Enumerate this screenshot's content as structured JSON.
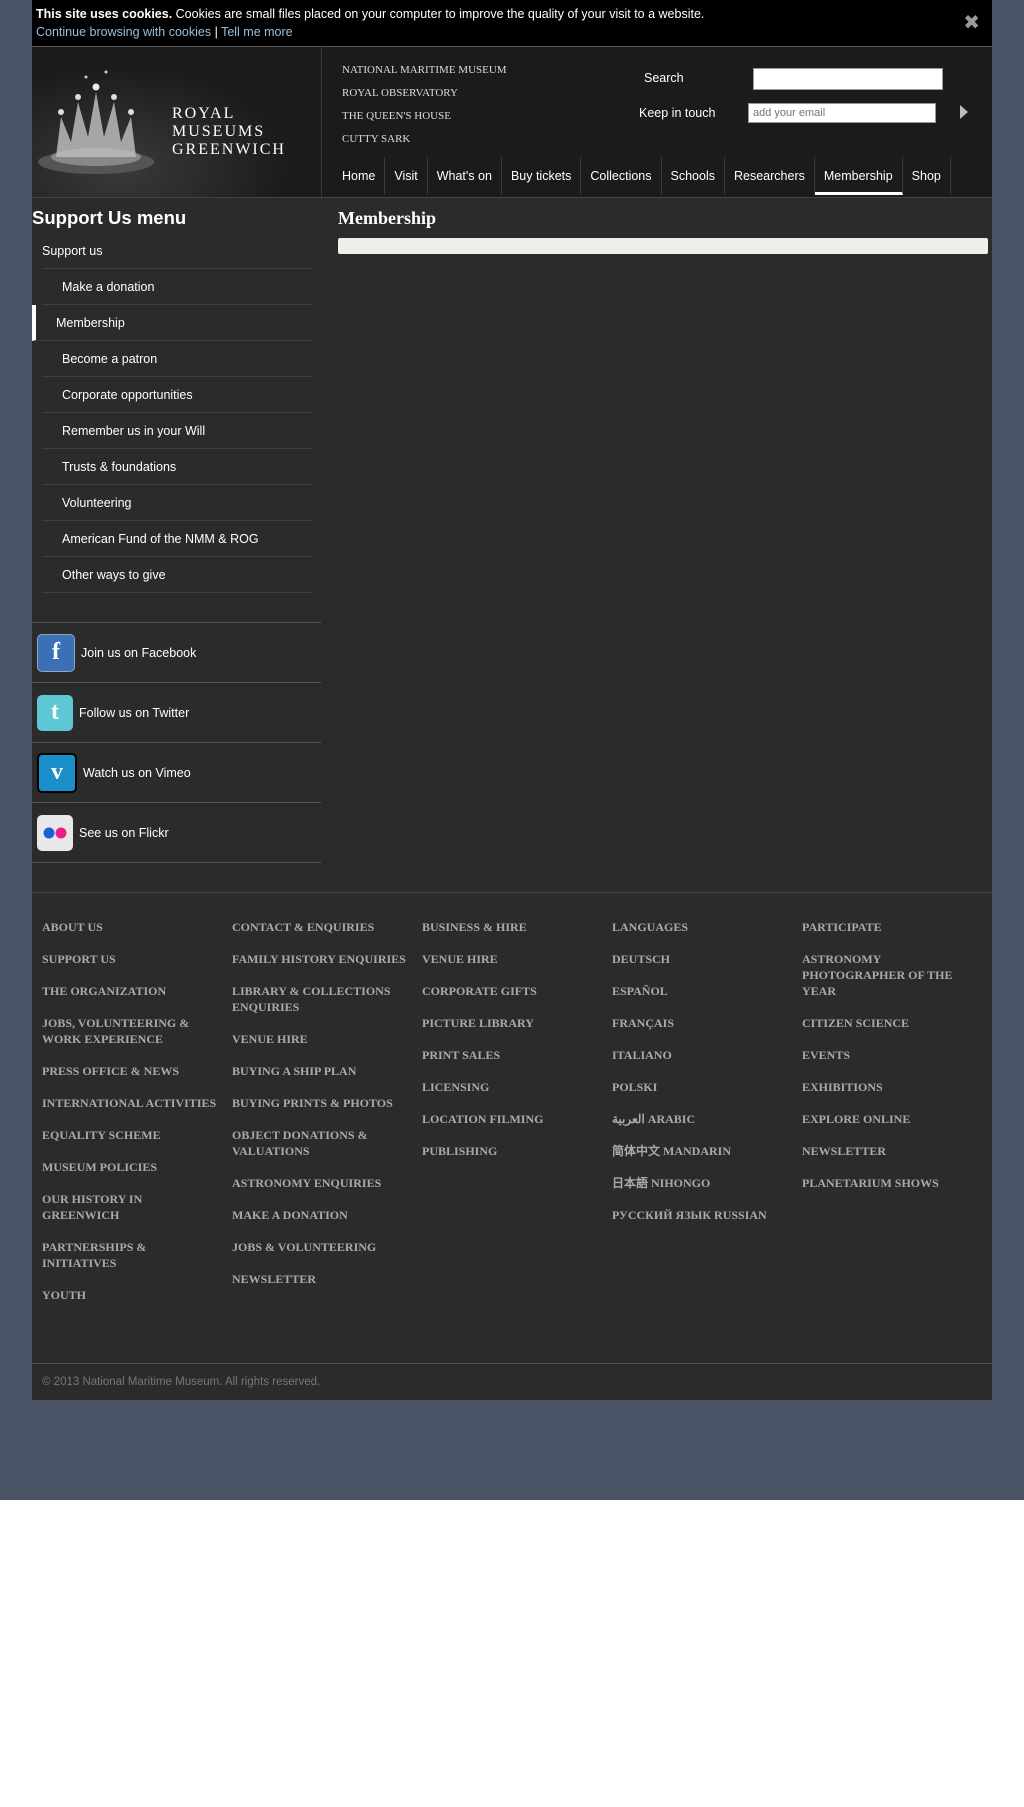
{
  "cookie": {
    "bold": "This site uses cookies.",
    "text": "Cookies are small files placed on your computer to improve the quality of your visit to a website.",
    "continue_link": "Continue browsing with cookies",
    "separator": "|",
    "tell_link": "Tell me more",
    "close_glyph": "✖"
  },
  "brand": {
    "line1": "ROYAL",
    "line2": "MUSEUMS",
    "line3": "GREENWICH"
  },
  "sites": [
    "NATIONAL MARITIME MUSEUM",
    "ROYAL OBSERVATORY",
    "THE QUEEN'S HOUSE",
    "CUTTY SARK"
  ],
  "search": {
    "label": "Search",
    "value": ""
  },
  "newsletter": {
    "label": "Keep in touch",
    "placeholder": "add your email"
  },
  "nav": [
    "Home",
    "Visit",
    "What's on",
    "Buy tickets",
    "Collections",
    "Schools",
    "Researchers",
    "Membership",
    "Shop"
  ],
  "nav_active": "Membership",
  "sidebar": {
    "title": "Support Us menu",
    "items": [
      "Support us",
      "Make a donation",
      "Membership",
      "Become a patron",
      "Corporate opportunities",
      "Remember us in your Will",
      "Trusts & foundations",
      "Volunteering",
      "American Fund of the NMM & ROG",
      "Other ways to give"
    ]
  },
  "social": [
    {
      "label": "Join us on Facebook",
      "icon": "facebook-icon",
      "color": "#3b6fb6"
    },
    {
      "label": "Follow us on Twitter",
      "icon": "twitter-icon",
      "color": "#5ec7d6"
    },
    {
      "label": "Watch us on Vimeo",
      "icon": "vimeo-icon",
      "color": "#1a8fc9"
    },
    {
      "label": "See us on Flickr",
      "icon": "flickr-icon",
      "color": "#e8e8e8"
    }
  ],
  "content": {
    "title": "Membership"
  },
  "footer": {
    "col1": [
      "ABOUT US",
      "SUPPORT US",
      "THE ORGANIZATION",
      "JOBS, VOLUNTEERING & WORK EXPERIENCE",
      "PRESS OFFICE & NEWS",
      "INTERNATIONAL ACTIVITIES",
      "EQUALITY SCHEME",
      "MUSEUM POLICIES",
      "OUR HISTORY IN GREENWICH",
      "PARTNERSHIPS & INITIATIVES",
      "YOUTH"
    ],
    "col2": [
      "CONTACT & ENQUIRIES",
      "FAMILY HISTORY ENQUIRIES",
      "LIBRARY & COLLECTIONS ENQUIRIES",
      "VENUE HIRE",
      "BUYING A SHIP PLAN",
      "BUYING PRINTS & PHOTOS",
      "OBJECT DONATIONS & VALUATIONS",
      "ASTRONOMY ENQUIRIES",
      "MAKE A DONATION",
      "JOBS & VOLUNTEERING",
      "NEWSLETTER"
    ],
    "col3": [
      "BUSINESS & HIRE",
      "VENUE HIRE",
      "CORPORATE GIFTS",
      "PICTURE LIBRARY",
      "PRINT SALES",
      "LICENSING",
      "LOCATION FILMING",
      "PUBLISHING"
    ],
    "col4": [
      "LANGUAGES",
      "DEUTSCH",
      "ESPAÑOL",
      "FRANÇAIS",
      "ITALIANO",
      "POLSKI",
      "العربية ARABIC",
      "简体中文 MANDARIN",
      "日本語 NIHONGO",
      "РУССКИЙ ЯЗЫК RUSSIAN"
    ],
    "col5": [
      "PARTICIPATE",
      "ASTRONOMY PHOTOGRAPHER OF THE YEAR",
      "CITIZEN SCIENCE",
      "EVENTS",
      "EXHIBITIONS",
      "EXPLORE ONLINE",
      "NEWSLETTER",
      "PLANETARIUM SHOWS"
    ],
    "copyright": "© 2013 National Maritime Museum. All rights reserved."
  },
  "colors": {
    "page_bg": "#4a5568",
    "panel": "#2b2b2b",
    "header": "#1b1b1b",
    "link": "#9bbedb"
  }
}
